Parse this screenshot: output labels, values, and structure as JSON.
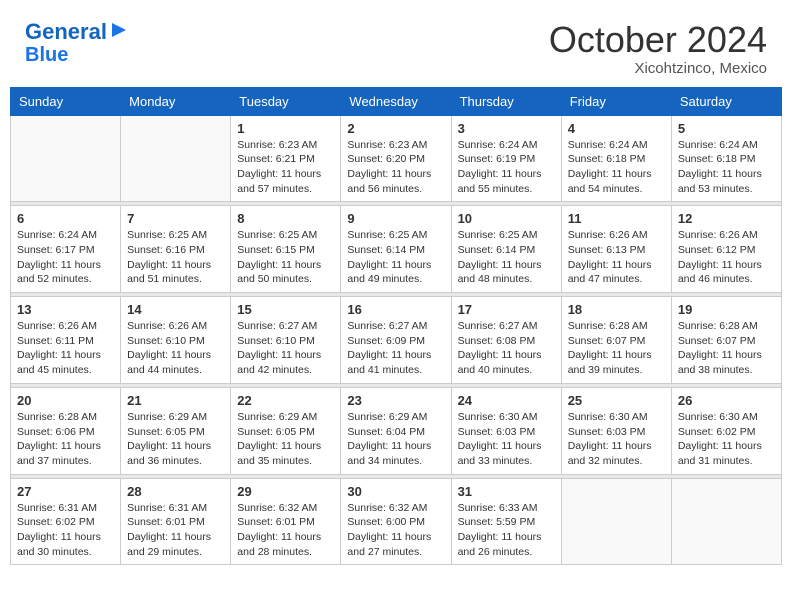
{
  "header": {
    "logo_line1": "General",
    "logo_line2": "Blue",
    "month": "October 2024",
    "location": "Xicohtzinco, Mexico"
  },
  "days_of_week": [
    "Sunday",
    "Monday",
    "Tuesday",
    "Wednesday",
    "Thursday",
    "Friday",
    "Saturday"
  ],
  "weeks": [
    [
      {
        "day": "",
        "info": ""
      },
      {
        "day": "",
        "info": ""
      },
      {
        "day": "1",
        "info": "Sunrise: 6:23 AM\nSunset: 6:21 PM\nDaylight: 11 hours and 57 minutes."
      },
      {
        "day": "2",
        "info": "Sunrise: 6:23 AM\nSunset: 6:20 PM\nDaylight: 11 hours and 56 minutes."
      },
      {
        "day": "3",
        "info": "Sunrise: 6:24 AM\nSunset: 6:19 PM\nDaylight: 11 hours and 55 minutes."
      },
      {
        "day": "4",
        "info": "Sunrise: 6:24 AM\nSunset: 6:18 PM\nDaylight: 11 hours and 54 minutes."
      },
      {
        "day": "5",
        "info": "Sunrise: 6:24 AM\nSunset: 6:18 PM\nDaylight: 11 hours and 53 minutes."
      }
    ],
    [
      {
        "day": "6",
        "info": "Sunrise: 6:24 AM\nSunset: 6:17 PM\nDaylight: 11 hours and 52 minutes."
      },
      {
        "day": "7",
        "info": "Sunrise: 6:25 AM\nSunset: 6:16 PM\nDaylight: 11 hours and 51 minutes."
      },
      {
        "day": "8",
        "info": "Sunrise: 6:25 AM\nSunset: 6:15 PM\nDaylight: 11 hours and 50 minutes."
      },
      {
        "day": "9",
        "info": "Sunrise: 6:25 AM\nSunset: 6:14 PM\nDaylight: 11 hours and 49 minutes."
      },
      {
        "day": "10",
        "info": "Sunrise: 6:25 AM\nSunset: 6:14 PM\nDaylight: 11 hours and 48 minutes."
      },
      {
        "day": "11",
        "info": "Sunrise: 6:26 AM\nSunset: 6:13 PM\nDaylight: 11 hours and 47 minutes."
      },
      {
        "day": "12",
        "info": "Sunrise: 6:26 AM\nSunset: 6:12 PM\nDaylight: 11 hours and 46 minutes."
      }
    ],
    [
      {
        "day": "13",
        "info": "Sunrise: 6:26 AM\nSunset: 6:11 PM\nDaylight: 11 hours and 45 minutes."
      },
      {
        "day": "14",
        "info": "Sunrise: 6:26 AM\nSunset: 6:10 PM\nDaylight: 11 hours and 44 minutes."
      },
      {
        "day": "15",
        "info": "Sunrise: 6:27 AM\nSunset: 6:10 PM\nDaylight: 11 hours and 42 minutes."
      },
      {
        "day": "16",
        "info": "Sunrise: 6:27 AM\nSunset: 6:09 PM\nDaylight: 11 hours and 41 minutes."
      },
      {
        "day": "17",
        "info": "Sunrise: 6:27 AM\nSunset: 6:08 PM\nDaylight: 11 hours and 40 minutes."
      },
      {
        "day": "18",
        "info": "Sunrise: 6:28 AM\nSunset: 6:07 PM\nDaylight: 11 hours and 39 minutes."
      },
      {
        "day": "19",
        "info": "Sunrise: 6:28 AM\nSunset: 6:07 PM\nDaylight: 11 hours and 38 minutes."
      }
    ],
    [
      {
        "day": "20",
        "info": "Sunrise: 6:28 AM\nSunset: 6:06 PM\nDaylight: 11 hours and 37 minutes."
      },
      {
        "day": "21",
        "info": "Sunrise: 6:29 AM\nSunset: 6:05 PM\nDaylight: 11 hours and 36 minutes."
      },
      {
        "day": "22",
        "info": "Sunrise: 6:29 AM\nSunset: 6:05 PM\nDaylight: 11 hours and 35 minutes."
      },
      {
        "day": "23",
        "info": "Sunrise: 6:29 AM\nSunset: 6:04 PM\nDaylight: 11 hours and 34 minutes."
      },
      {
        "day": "24",
        "info": "Sunrise: 6:30 AM\nSunset: 6:03 PM\nDaylight: 11 hours and 33 minutes."
      },
      {
        "day": "25",
        "info": "Sunrise: 6:30 AM\nSunset: 6:03 PM\nDaylight: 11 hours and 32 minutes."
      },
      {
        "day": "26",
        "info": "Sunrise: 6:30 AM\nSunset: 6:02 PM\nDaylight: 11 hours and 31 minutes."
      }
    ],
    [
      {
        "day": "27",
        "info": "Sunrise: 6:31 AM\nSunset: 6:02 PM\nDaylight: 11 hours and 30 minutes."
      },
      {
        "day": "28",
        "info": "Sunrise: 6:31 AM\nSunset: 6:01 PM\nDaylight: 11 hours and 29 minutes."
      },
      {
        "day": "29",
        "info": "Sunrise: 6:32 AM\nSunset: 6:01 PM\nDaylight: 11 hours and 28 minutes."
      },
      {
        "day": "30",
        "info": "Sunrise: 6:32 AM\nSunset: 6:00 PM\nDaylight: 11 hours and 27 minutes."
      },
      {
        "day": "31",
        "info": "Sunrise: 6:33 AM\nSunset: 5:59 PM\nDaylight: 11 hours and 26 minutes."
      },
      {
        "day": "",
        "info": ""
      },
      {
        "day": "",
        "info": ""
      }
    ]
  ]
}
